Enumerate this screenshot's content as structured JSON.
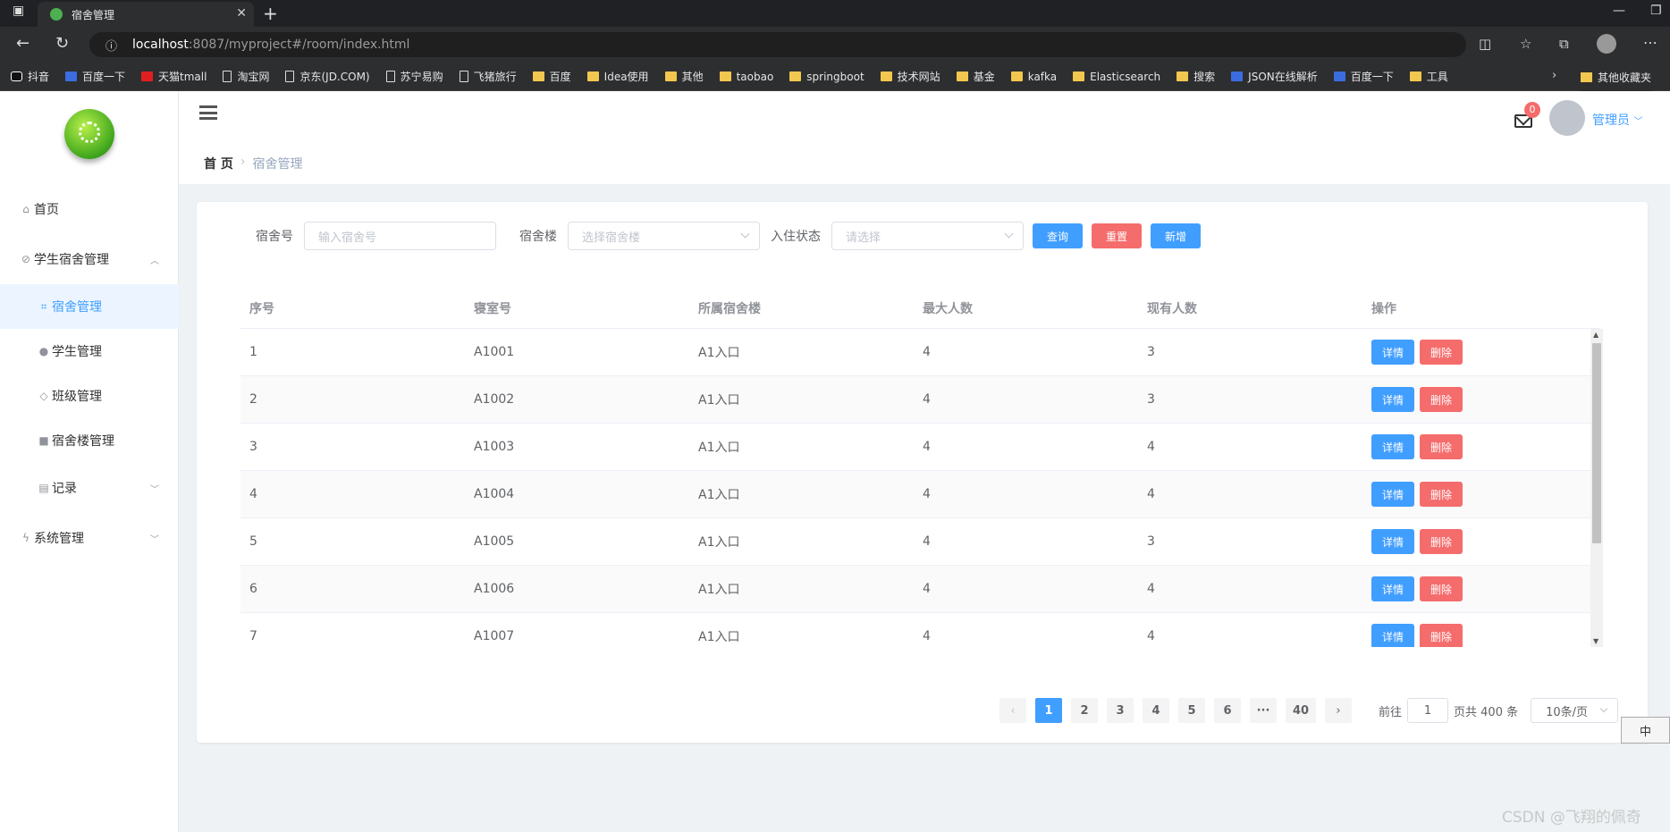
{
  "browser": {
    "tab_title": "宿舍管理",
    "url_host": "localhost",
    "url_rest": ":8087/myproject#/room/index.html",
    "bookmarks": [
      "抖音",
      "百度一下",
      "天猫tmall",
      "淘宝网",
      "京东(JD.COM)",
      "苏宁易购",
      "飞猪旅行",
      "百度",
      "Idea使用",
      "其他",
      "taobao",
      "springboot",
      "技术网站",
      "基金",
      "kafka",
      "Elasticsearch",
      "搜索",
      "JSON在线解析",
      "百度一下",
      "工具"
    ],
    "other_bookmarks": "其他收藏夹"
  },
  "sidebar": {
    "items": [
      {
        "label": "首页",
        "icon": "home-icon"
      },
      {
        "label": "学生宿舍管理",
        "icon": "paperclip-icon"
      },
      {
        "label": "宿舍管理",
        "icon": "crop-icon"
      },
      {
        "label": "学生管理",
        "icon": "user-icon"
      },
      {
        "label": "班级管理",
        "icon": "stack-icon"
      },
      {
        "label": "宿舍楼管理",
        "icon": "house-icon"
      },
      {
        "label": "记录",
        "icon": "document-icon"
      },
      {
        "label": "系统管理",
        "icon": "lightning-icon"
      }
    ]
  },
  "header": {
    "breadcrumb_home": "首 页",
    "breadcrumb_current": "宿舍管理",
    "notification_count": "0",
    "user_name": "管理员"
  },
  "filters": {
    "room_label": "宿舍号",
    "room_placeholder": "输入宿舍号",
    "building_label": "宿舍楼",
    "building_placeholder": "选择宿舍楼",
    "status_label": "入住状态",
    "status_placeholder": "请选择",
    "query": "查询",
    "reset": "重置",
    "add": "新增"
  },
  "table": {
    "headers": [
      "序号",
      "寝室号",
      "所属宿舍楼",
      "最大人数",
      "现有人数",
      "操作"
    ],
    "detail_label": "详情",
    "delete_label": "删除",
    "rows": [
      [
        "1",
        "A1001",
        "A1入口",
        "4",
        "3"
      ],
      [
        "2",
        "A1002",
        "A1入口",
        "4",
        "3"
      ],
      [
        "3",
        "A1003",
        "A1入口",
        "4",
        "4"
      ],
      [
        "4",
        "A1004",
        "A1入口",
        "4",
        "4"
      ],
      [
        "5",
        "A1005",
        "A1入口",
        "4",
        "3"
      ],
      [
        "6",
        "A1006",
        "A1入口",
        "4",
        "4"
      ],
      [
        "7",
        "A1007",
        "A1入口",
        "4",
        "4"
      ]
    ]
  },
  "pagination": {
    "pages": [
      "1",
      "2",
      "3",
      "4",
      "5",
      "6",
      "···",
      "40"
    ],
    "current": "1",
    "goto_label": "前往",
    "goto_value": "1",
    "total_label": "页共 400 条",
    "page_size": "10条/页"
  },
  "ime": "中",
  "watermark": "CSDN @飞翔的佩奇"
}
